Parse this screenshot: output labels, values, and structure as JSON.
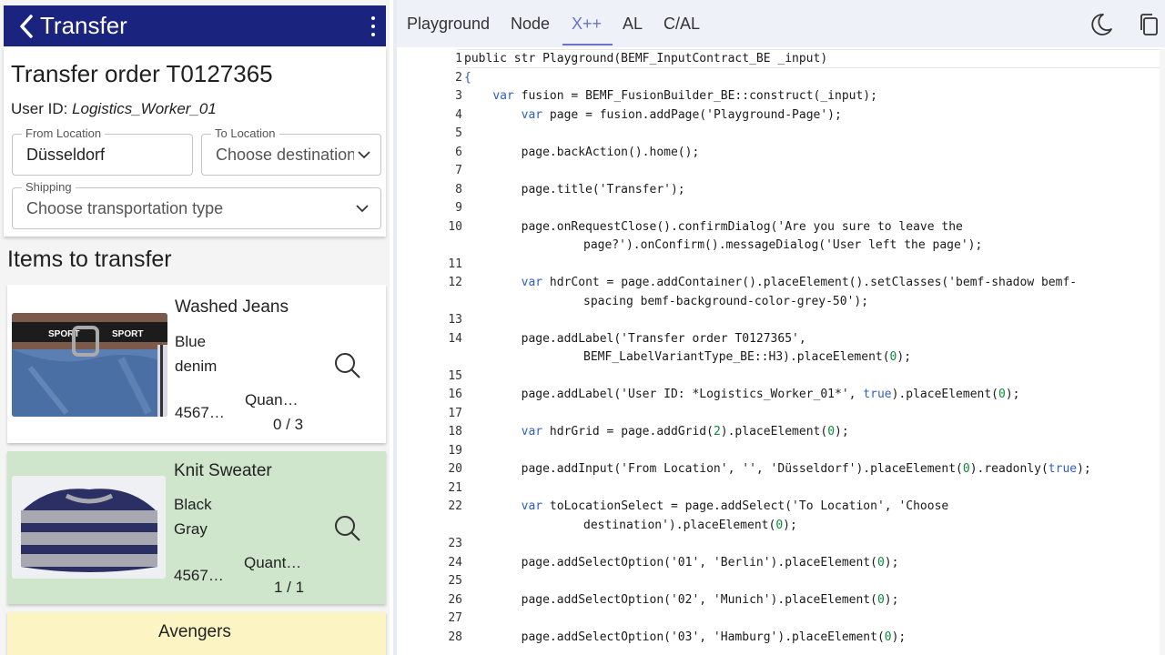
{
  "app": {
    "title": "Transfer",
    "colors": {
      "appbar": "#1a237e",
      "accent": "#6a73c9",
      "selected_card": "#cfe6cc",
      "warning_card": "#fdf4c4"
    }
  },
  "header": {
    "order_title": "Transfer order T0127365",
    "user_prefix": "User ID: ",
    "user_name": "Logistics_Worker_01",
    "from_location": {
      "label": "From Location",
      "value": "Düsseldorf"
    },
    "to_location": {
      "label": "To Location",
      "placeholder": "Choose destination"
    },
    "shipping": {
      "label": "Shipping",
      "placeholder": "Choose transportation type"
    }
  },
  "items_title": "Items to transfer",
  "items": [
    {
      "name": "Washed Jeans",
      "attr1": "Blue",
      "attr2": "denim",
      "sku": "4567…",
      "qty_label": "Quan…",
      "qty": "0 / 3"
    },
    {
      "name": "Knit Sweater",
      "attr1": "Black",
      "attr2": "Gray",
      "sku": "4567…",
      "qty_label": "Quant…",
      "qty": "1 / 1"
    },
    {
      "name": "Avengers"
    }
  ],
  "editor": {
    "tabs": [
      "Playground",
      "Node",
      "X++",
      "AL",
      "C/AL"
    ],
    "active_tab": "X++",
    "icons": [
      "moon-icon",
      "copy-icon"
    ],
    "lines": [
      {
        "n": "1",
        "text": "public str Playground(BEMF_InputContract_BE _input)"
      },
      {
        "n": "2",
        "text": "{"
      },
      {
        "n": "3",
        "text": "    var fusion = BEMF_FusionBuilder_BE::construct(_input);"
      },
      {
        "n": "4",
        "text": "        var page = fusion.addPage('Playground-Page');"
      },
      {
        "n": "5",
        "text": ""
      },
      {
        "n": "6",
        "text": "        page.backAction().home();"
      },
      {
        "n": "7",
        "text": ""
      },
      {
        "n": "8",
        "text": "        page.title('Transfer');"
      },
      {
        "n": "9",
        "text": ""
      },
      {
        "n": "10",
        "text": "        page.onRequestClose().confirmDialog('Are you sure to leave the"
      },
      {
        "n": "",
        "text": "page?').onConfirm().messageDialog('User left the page');"
      },
      {
        "n": "11",
        "text": ""
      },
      {
        "n": "12",
        "text": "        var hdrCont = page.addContainer().placeElement().setClasses('bemf-shadow bemf-"
      },
      {
        "n": "",
        "text": "spacing bemf-background-color-grey-50');"
      },
      {
        "n": "13",
        "text": ""
      },
      {
        "n": "14",
        "text": "        page.addLabel('Transfer order T0127365',"
      },
      {
        "n": "",
        "text": "BEMF_LabelVariantType_BE::H3).placeElement(0);"
      },
      {
        "n": "15",
        "text": ""
      },
      {
        "n": "16",
        "text": "        page.addLabel('User ID: *Logistics_Worker_01*', true).placeElement(0);"
      },
      {
        "n": "17",
        "text": ""
      },
      {
        "n": "18",
        "text": "        var hdrGrid = page.addGrid(2).placeElement(0);"
      },
      {
        "n": "19",
        "text": ""
      },
      {
        "n": "20",
        "text": "        page.addInput('From Location', '', 'Düsseldorf').placeElement(0).readonly(true);"
      },
      {
        "n": "21",
        "text": ""
      },
      {
        "n": "22",
        "text": "        var toLocationSelect = page.addSelect('To Location', 'Choose"
      },
      {
        "n": "",
        "text": "destination').placeElement(0);"
      },
      {
        "n": "23",
        "text": ""
      },
      {
        "n": "24",
        "text": "        page.addSelectOption('01', 'Berlin').placeElement(0);"
      },
      {
        "n": "25",
        "text": ""
      },
      {
        "n": "26",
        "text": "        page.addSelectOption('02', 'Munich').placeElement(0);"
      },
      {
        "n": "27",
        "text": ""
      },
      {
        "n": "28",
        "text": "        page.addSelectOption('03', 'Hamburg').placeElement(0);"
      }
    ]
  }
}
